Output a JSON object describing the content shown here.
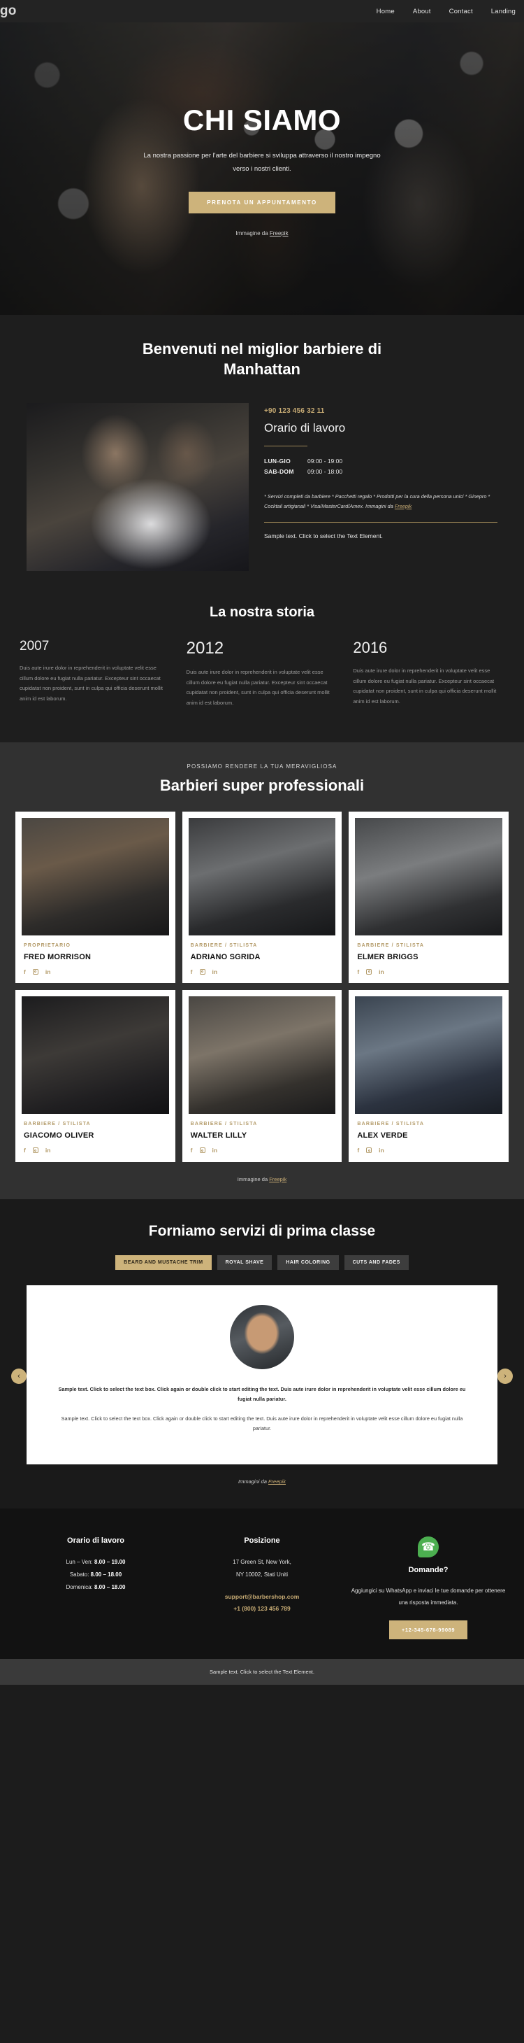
{
  "header": {
    "logo": "ogo",
    "nav": [
      "Home",
      "About",
      "Contact",
      "Landing"
    ]
  },
  "hero": {
    "title": "CHI SIAMO",
    "subtitle": "La nostra passione per l'arte del barbiere si sviluppa attraverso il nostro impegno verso i nostri clienti.",
    "button": "PRENOTA UN APPUNTAMENTO",
    "credit_prefix": "Immagine da ",
    "credit_link": "Freepik"
  },
  "welcome": {
    "title": "Benvenuti nel miglior barbiere di Manhattan",
    "phone": "+90 123 456 32 11",
    "info_title": "Orario di lavoro",
    "hours": [
      {
        "day": "LUN-GIO",
        "value": "09:00 - 19:00"
      },
      {
        "day": "SAB-DOM",
        "value": "09:00 - 18:00"
      }
    ],
    "fineprint": "* Servizi completi da barbiere * Pacchetti regalo * Prodotti per la cura della persona unici * Ginepro * Cocktail artigianali * Visa/MasterCard/Amex. Immagini da ",
    "fineprint_link": "Freepik",
    "sample_note": "Sample text. Click to select the Text Element."
  },
  "story": {
    "title": "La nostra storia",
    "arrow_left": "‹",
    "arrow_right": "›",
    "items": [
      {
        "year": "2007",
        "text": "Duis aute irure dolor in reprehenderit in voluptate velit esse cillum dolore eu fugiat nulla pariatur. Excepteur sint occaecat cupidatat non proident, sunt in culpa qui officia deserunt mollit anim id est laborum."
      },
      {
        "year": "2012",
        "text": "Duis aute irure dolor in reprehenderit in voluptate velit esse cillum dolore eu fugiat nulla pariatur. Excepteur sint occaecat cupidatat non proident, sunt in culpa qui officia deserunt mollit anim id est laborum."
      },
      {
        "year": "2016",
        "text": "Duis aute irure dolor in reprehenderit in voluptate velit esse cillum dolore eu fugiat nulla pariatur. Excepteur sint occaecat cupidatat non proident, sunt in culpa qui officia deserunt mollit anim id est laborum."
      }
    ]
  },
  "barbers": {
    "eyebrow": "POSSIAMO RENDERE LA TUA MERAVIGLIOSA",
    "title": "Barbieri super professionali",
    "credit_prefix": "Immagine da ",
    "credit_link": "Freepik",
    "social": {
      "facebook": "f",
      "instagram": "instagram-icon",
      "linkedin": "in"
    },
    "people": [
      {
        "role": "PROPRIETARIO",
        "name": "FRED MORRISON"
      },
      {
        "role": "BARBIERE / STILISTA",
        "name": "ADRIANO SGRIDA"
      },
      {
        "role": "BARBIERE / STILISTA",
        "name": "ELMER BRIGGS"
      },
      {
        "role": "BARBIERE / STILISTA",
        "name": "GIACOMO OLIVER"
      },
      {
        "role": "BARBIERE / STILISTA",
        "name": "WALTER LILLY"
      },
      {
        "role": "BARBIERE / STILISTA",
        "name": "ALEX VERDE"
      }
    ]
  },
  "services": {
    "title": "Forniamo servizi di prima classe",
    "tabs": [
      "BEARD AND MUSTACHE TRIM",
      "ROYAL SHAVE",
      "HAIR COLORING",
      "CUTS AND FADES"
    ],
    "active_tab": 0,
    "paragraph_bold": "Sample text. Click to select the text box. Click again or double click to start editing the text. Duis aute irure dolor in reprehenderit in voluptate velit esse cillum dolore eu fugiat nulla pariatur.",
    "paragraph_normal": "Sample text. Click to select the text box. Click again or double click to start editing the text. Duis aute irure dolor in reprehenderit in voluptate velit esse cillum dolore eu fugiat nulla pariatur.",
    "credit_prefix": "Immagini da ",
    "credit_link": "Freepik"
  },
  "footer": {
    "col1": {
      "heading": "Orario di lavoro",
      "lines": [
        {
          "label": "Lun – Ven: ",
          "value": "8.00 – 19.00"
        },
        {
          "label": "Sabato: ",
          "value": "8.00 – 18.00"
        },
        {
          "label": "Domenica: ",
          "value": "8.00 – 18.00"
        }
      ]
    },
    "col2": {
      "heading": "Posizione",
      "address_line1": "17 Green St, New York,",
      "address_line2": "NY 10002, Stati Uniti",
      "email": "support@barbershop.com",
      "phone": "+1 (800) 123 456 789"
    },
    "col3": {
      "icon": "whatsapp-icon",
      "heading": "Domande?",
      "text": "Aggiungici su WhatsApp e inviaci le tue domande per ottenere una risposta immediata.",
      "button": "+12-345-678-99089"
    },
    "bottom": "Sample text. Click to select the Text Element."
  }
}
